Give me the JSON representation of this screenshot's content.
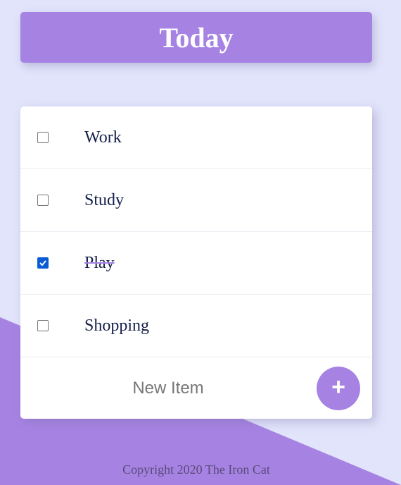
{
  "colors": {
    "accent": "#a683e3",
    "background": "#e1e4fb",
    "checkbox_checked": "#0a5bd6",
    "text": "#13204a"
  },
  "header": {
    "title": "Today"
  },
  "todo": {
    "items": [
      {
        "label": "Work",
        "checked": false
      },
      {
        "label": "Study",
        "checked": false
      },
      {
        "label": "Play",
        "checked": true
      },
      {
        "label": "Shopping",
        "checked": false
      }
    ],
    "new_item_placeholder": "New Item",
    "add_button_label": "+"
  },
  "footer": {
    "copyright": "Copyright 2020 The Iron Cat"
  }
}
